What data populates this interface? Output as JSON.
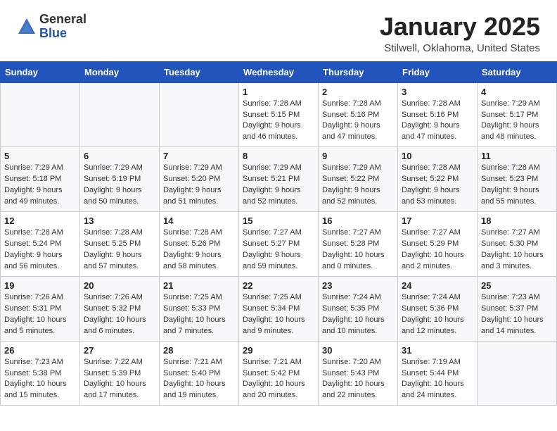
{
  "header": {
    "logo_general": "General",
    "logo_blue": "Blue",
    "month_title": "January 2025",
    "location": "Stilwell, Oklahoma, United States"
  },
  "days_of_week": [
    "Sunday",
    "Monday",
    "Tuesday",
    "Wednesday",
    "Thursday",
    "Friday",
    "Saturday"
  ],
  "weeks": [
    [
      {
        "num": "",
        "info": ""
      },
      {
        "num": "",
        "info": ""
      },
      {
        "num": "",
        "info": ""
      },
      {
        "num": "1",
        "info": "Sunrise: 7:28 AM\nSunset: 5:15 PM\nDaylight: 9 hours\nand 46 minutes."
      },
      {
        "num": "2",
        "info": "Sunrise: 7:28 AM\nSunset: 5:16 PM\nDaylight: 9 hours\nand 47 minutes."
      },
      {
        "num": "3",
        "info": "Sunrise: 7:28 AM\nSunset: 5:16 PM\nDaylight: 9 hours\nand 47 minutes."
      },
      {
        "num": "4",
        "info": "Sunrise: 7:29 AM\nSunset: 5:17 PM\nDaylight: 9 hours\nand 48 minutes."
      }
    ],
    [
      {
        "num": "5",
        "info": "Sunrise: 7:29 AM\nSunset: 5:18 PM\nDaylight: 9 hours\nand 49 minutes."
      },
      {
        "num": "6",
        "info": "Sunrise: 7:29 AM\nSunset: 5:19 PM\nDaylight: 9 hours\nand 50 minutes."
      },
      {
        "num": "7",
        "info": "Sunrise: 7:29 AM\nSunset: 5:20 PM\nDaylight: 9 hours\nand 51 minutes."
      },
      {
        "num": "8",
        "info": "Sunrise: 7:29 AM\nSunset: 5:21 PM\nDaylight: 9 hours\nand 52 minutes."
      },
      {
        "num": "9",
        "info": "Sunrise: 7:29 AM\nSunset: 5:22 PM\nDaylight: 9 hours\nand 52 minutes."
      },
      {
        "num": "10",
        "info": "Sunrise: 7:28 AM\nSunset: 5:22 PM\nDaylight: 9 hours\nand 53 minutes."
      },
      {
        "num": "11",
        "info": "Sunrise: 7:28 AM\nSunset: 5:23 PM\nDaylight: 9 hours\nand 55 minutes."
      }
    ],
    [
      {
        "num": "12",
        "info": "Sunrise: 7:28 AM\nSunset: 5:24 PM\nDaylight: 9 hours\nand 56 minutes."
      },
      {
        "num": "13",
        "info": "Sunrise: 7:28 AM\nSunset: 5:25 PM\nDaylight: 9 hours\nand 57 minutes."
      },
      {
        "num": "14",
        "info": "Sunrise: 7:28 AM\nSunset: 5:26 PM\nDaylight: 9 hours\nand 58 minutes."
      },
      {
        "num": "15",
        "info": "Sunrise: 7:27 AM\nSunset: 5:27 PM\nDaylight: 9 hours\nand 59 minutes."
      },
      {
        "num": "16",
        "info": "Sunrise: 7:27 AM\nSunset: 5:28 PM\nDaylight: 10 hours\nand 0 minutes."
      },
      {
        "num": "17",
        "info": "Sunrise: 7:27 AM\nSunset: 5:29 PM\nDaylight: 10 hours\nand 2 minutes."
      },
      {
        "num": "18",
        "info": "Sunrise: 7:27 AM\nSunset: 5:30 PM\nDaylight: 10 hours\nand 3 minutes."
      }
    ],
    [
      {
        "num": "19",
        "info": "Sunrise: 7:26 AM\nSunset: 5:31 PM\nDaylight: 10 hours\nand 5 minutes."
      },
      {
        "num": "20",
        "info": "Sunrise: 7:26 AM\nSunset: 5:32 PM\nDaylight: 10 hours\nand 6 minutes."
      },
      {
        "num": "21",
        "info": "Sunrise: 7:25 AM\nSunset: 5:33 PM\nDaylight: 10 hours\nand 7 minutes."
      },
      {
        "num": "22",
        "info": "Sunrise: 7:25 AM\nSunset: 5:34 PM\nDaylight: 10 hours\nand 9 minutes."
      },
      {
        "num": "23",
        "info": "Sunrise: 7:24 AM\nSunset: 5:35 PM\nDaylight: 10 hours\nand 10 minutes."
      },
      {
        "num": "24",
        "info": "Sunrise: 7:24 AM\nSunset: 5:36 PM\nDaylight: 10 hours\nand 12 minutes."
      },
      {
        "num": "25",
        "info": "Sunrise: 7:23 AM\nSunset: 5:37 PM\nDaylight: 10 hours\nand 14 minutes."
      }
    ],
    [
      {
        "num": "26",
        "info": "Sunrise: 7:23 AM\nSunset: 5:38 PM\nDaylight: 10 hours\nand 15 minutes."
      },
      {
        "num": "27",
        "info": "Sunrise: 7:22 AM\nSunset: 5:39 PM\nDaylight: 10 hours\nand 17 minutes."
      },
      {
        "num": "28",
        "info": "Sunrise: 7:21 AM\nSunset: 5:40 PM\nDaylight: 10 hours\nand 19 minutes."
      },
      {
        "num": "29",
        "info": "Sunrise: 7:21 AM\nSunset: 5:42 PM\nDaylight: 10 hours\nand 20 minutes."
      },
      {
        "num": "30",
        "info": "Sunrise: 7:20 AM\nSunset: 5:43 PM\nDaylight: 10 hours\nand 22 minutes."
      },
      {
        "num": "31",
        "info": "Sunrise: 7:19 AM\nSunset: 5:44 PM\nDaylight: 10 hours\nand 24 minutes."
      },
      {
        "num": "",
        "info": ""
      }
    ]
  ]
}
